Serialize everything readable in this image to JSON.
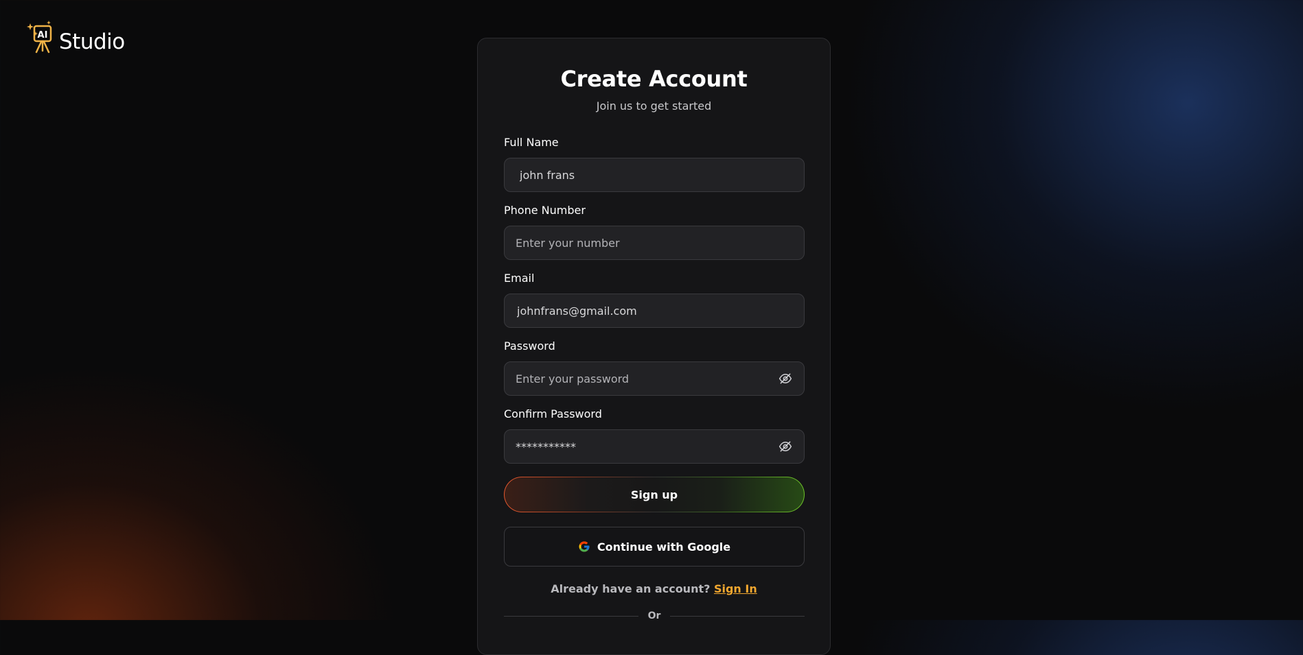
{
  "brand": {
    "name": "Studio",
    "mark_text": "AI",
    "icon": "ai-studio-logo-icon",
    "accent_color": "#f0b347"
  },
  "form": {
    "title": "Create Account",
    "subtitle": "Join us to get started",
    "full_name": {
      "label": "Full Name",
      "value": "john frans",
      "placeholder": ""
    },
    "phone": {
      "label": "Phone Number",
      "value": "",
      "placeholder": "Enter your number"
    },
    "email": {
      "label": "Email",
      "value": "johnfrans@gmail.com",
      "placeholder": ""
    },
    "password": {
      "label": "Password",
      "value": "",
      "placeholder": "Enter your password",
      "toggle_icon": "eye-off-icon"
    },
    "confirm_password": {
      "label": "Confirm Password",
      "value": "***********",
      "placeholder": "",
      "toggle_icon": "eye-off-icon"
    },
    "signup_label": "Sign up",
    "google_label": "Continue with Google",
    "google_icon": "google-icon",
    "signin_prompt": "Already have an account?",
    "signin_link": "Sign In",
    "divider_text": "Or"
  },
  "colors": {
    "background": "#0a0a0b",
    "card": "#151517",
    "input_bg": "#222225",
    "link": "#f0a62f",
    "signup_gradient_start": "#e4572e",
    "signup_gradient_end": "#6fc32a"
  }
}
